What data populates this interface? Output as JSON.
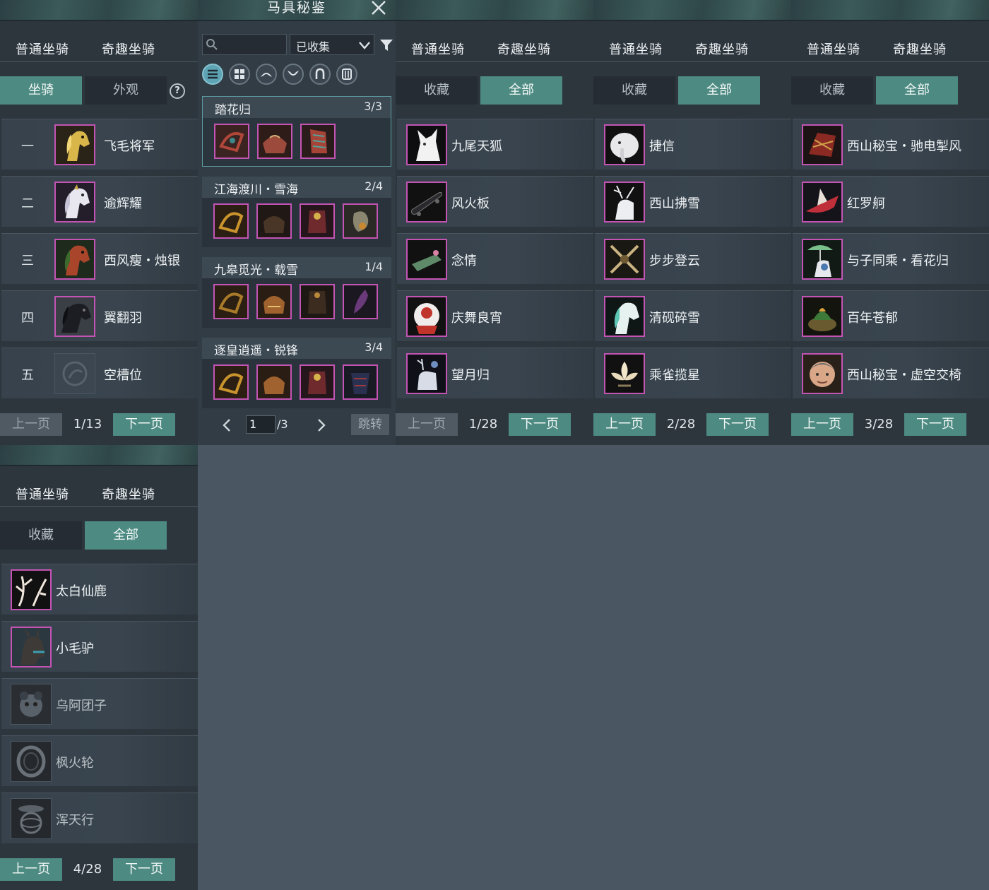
{
  "colors": {
    "accent": "#4d8a82",
    "rarity_border": "#c354b4",
    "background": "#4a5763",
    "panel": "#2d353d"
  },
  "main_tabs": [
    "普通坐骑",
    "奇趣坐骑"
  ],
  "panel1": {
    "subtabs": [
      "坐骑",
      "外观"
    ],
    "help": "?",
    "rows": [
      {
        "num": "一",
        "label": "飞毛将军",
        "icon": "golden-horse-icon"
      },
      {
        "num": "二",
        "label": "逾辉耀",
        "icon": "white-horse-icon"
      },
      {
        "num": "三",
        "label": "西风瘦・烛银",
        "icon": "chestnut-horse-icon"
      },
      {
        "num": "四",
        "label": "翼翻羽",
        "icon": "black-horse-icon"
      },
      {
        "num": "五",
        "label": "空槽位",
        "icon": "empty-slot-icon"
      }
    ],
    "pager": {
      "prev": "上一页",
      "page": "1/13",
      "next": "下一页"
    }
  },
  "panel2": {
    "title": "马具秘鉴",
    "close": "✕",
    "search_placeholder": "",
    "select_value": "已收集",
    "sets": [
      {
        "name": "踏花归",
        "count": "3/3"
      },
      {
        "name": "江海渡川・雪海",
        "count": "2/4"
      },
      {
        "name": "九皋觅光・载雪",
        "count": "1/4"
      },
      {
        "name": "逐皇逍遥・锐锋",
        "count": "3/4"
      }
    ],
    "pager": {
      "page_value": "1",
      "page_total": "/3",
      "jump": "跳转"
    }
  },
  "panel3": {
    "subtabs": [
      "收藏",
      "全部"
    ],
    "rows": [
      "九尾天狐",
      "风火板",
      "念情",
      "庆舞良宵",
      "望月归"
    ],
    "pager": {
      "prev": "上一页",
      "page": "1/28",
      "next": "下一页"
    }
  },
  "panel4": {
    "subtabs": [
      "收藏",
      "全部"
    ],
    "rows": [
      "捷信",
      "西山拂雪",
      "步步登云",
      "清砚碎雪",
      "乘雀揽星"
    ],
    "pager": {
      "prev": "上一页",
      "page": "2/28",
      "next": "下一页"
    }
  },
  "panel5": {
    "subtabs": [
      "收藏",
      "全部"
    ],
    "rows": [
      "西山秘宝・驰电掣风",
      "红罗舸",
      "与子同乘・看花归",
      "百年苍郁",
      "西山秘宝・虚空交椅"
    ],
    "pager": {
      "prev": "上一页",
      "page": "3/28",
      "next": "下一页"
    }
  },
  "panel6": {
    "subtabs": [
      "收藏",
      "全部"
    ],
    "rows": [
      "太白仙鹿",
      "小毛驴",
      "乌阿团子",
      "枫火轮",
      "浑天行"
    ],
    "pager": {
      "prev": "上一页",
      "page": "4/28",
      "next": "下一页"
    }
  }
}
